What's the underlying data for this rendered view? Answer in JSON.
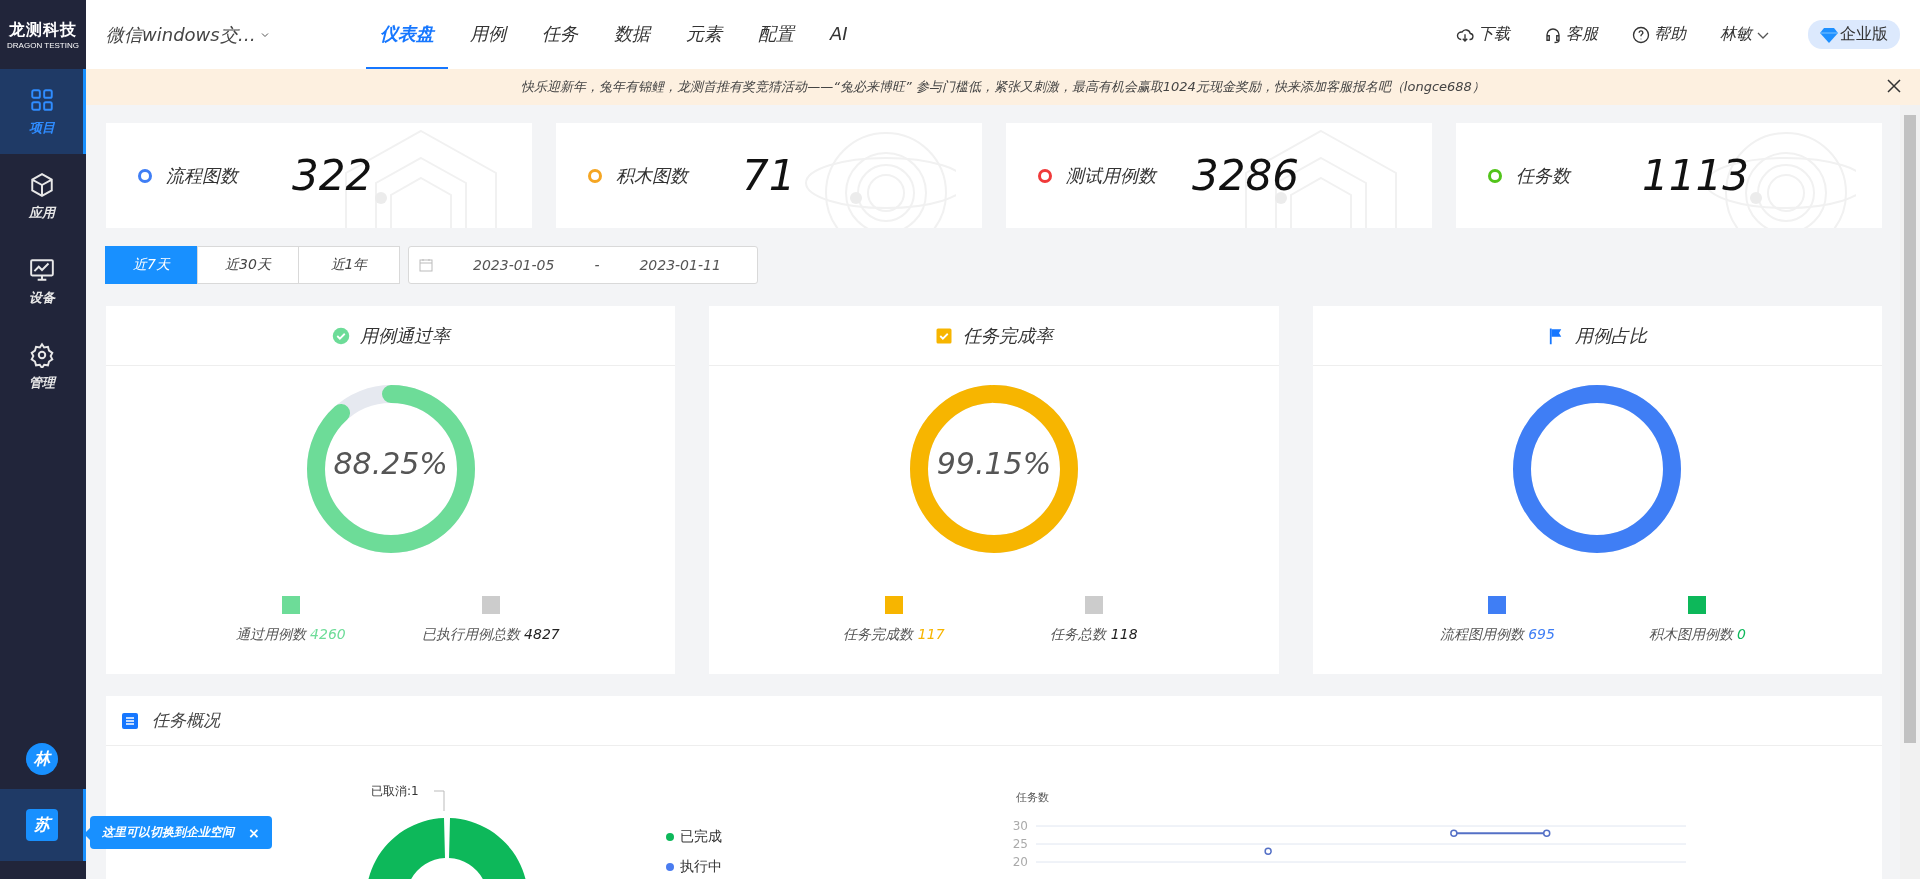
{
  "sidebar": {
    "logo": {
      "title": "龙测科技",
      "subtitle": "DRAGON TESTING"
    },
    "items": [
      {
        "label": "项目",
        "selected": true
      },
      {
        "label": "应用",
        "selected": false
      },
      {
        "label": "设备",
        "selected": false
      },
      {
        "label": "管理",
        "selected": false
      }
    ],
    "avatars": [
      {
        "text": "林",
        "selected": false
      },
      {
        "text": "苏",
        "selected": true
      }
    ],
    "tooltip": {
      "text": "这里可以切换到企业空间",
      "close": "×"
    }
  },
  "header": {
    "project": "微信windows交…",
    "tabs": [
      {
        "label": "仪表盘",
        "selected": true
      },
      {
        "label": "用例",
        "selected": false
      },
      {
        "label": "任务",
        "selected": false
      },
      {
        "label": "数据",
        "selected": false
      },
      {
        "label": "元素",
        "selected": false
      },
      {
        "label": "配置",
        "selected": false
      },
      {
        "label": "AI",
        "selected": false
      }
    ],
    "actions": [
      {
        "label": "下载"
      },
      {
        "label": "客服"
      },
      {
        "label": "帮助"
      }
    ],
    "user": "林敏",
    "edition": "企业版"
  },
  "banner": {
    "text": "快乐迎新年，兔年有锦鲤，龙测首推有奖竞猜活动——“兔必来博旺” 参与门槛低，紧张又刺激，最高有机会赢取1024元现金奖励，快来添加客服报名吧（longce688）"
  },
  "stats": [
    {
      "label": "流程图数",
      "value": "322",
      "color": "#3f7ef5"
    },
    {
      "label": "积木图数",
      "value": "71",
      "color": "#f5a623"
    },
    {
      "label": "测试用例数",
      "value": "3286",
      "color": "#f03a3a"
    },
    {
      "label": "任务数",
      "value": "1113",
      "color": "#52c41a"
    }
  ],
  "ranges": [
    {
      "label": "近7天",
      "selected": true
    },
    {
      "label": "近30天",
      "selected": false
    },
    {
      "label": "近1年",
      "selected": false
    }
  ],
  "date_range": {
    "start": "2023-01-05",
    "separator": "-",
    "end": "2023-01-11"
  },
  "panels": [
    {
      "title": "用例通过率",
      "level": 0.8825,
      "color": "#6ddc98",
      "center": "88.25%",
      "legend": [
        {
          "label": "通过用例数",
          "value": "4260",
          "color": "#6ddc98"
        },
        {
          "label": "已执行用例总数",
          "value": "4827",
          "color": "#cccccc"
        }
      ]
    },
    {
      "title": "任务完成率",
      "level": 0.9915,
      "color": "#f7b500",
      "center": "99.15%",
      "legend": [
        {
          "label": "任务完成数",
          "value": "117",
          "color": "#f7b500"
        },
        {
          "label": "任务总数",
          "value": "118",
          "color": "#cccccc"
        }
      ]
    },
    {
      "title": "用例占比",
      "level": 1,
      "color": "#3f7ef5",
      "legend": [
        {
          "label": "流程图用例数",
          "value": "695",
          "color": "#3f7ef5"
        },
        {
          "label": "积木图用例数",
          "value": "0",
          "color": "#0db85a"
        }
      ]
    }
  ],
  "overview": {
    "title": "任务概况",
    "donut_label": "已取消:1",
    "legend": [
      {
        "label": "已完成",
        "color": "#0db85a"
      },
      {
        "label": "执行中",
        "color": "#4a7cf0"
      }
    ],
    "chart_data": {
      "type": "line",
      "ylabel": "任务数",
      "ylim": [
        20,
        30
      ],
      "yticks": [
        20,
        25,
        30
      ],
      "series": [
        {
          "color": "#5470c6",
          "marker": "circle",
          "values": [
            null,
            null,
            23,
            null,
            28,
            28,
            null
          ]
        }
      ]
    }
  }
}
